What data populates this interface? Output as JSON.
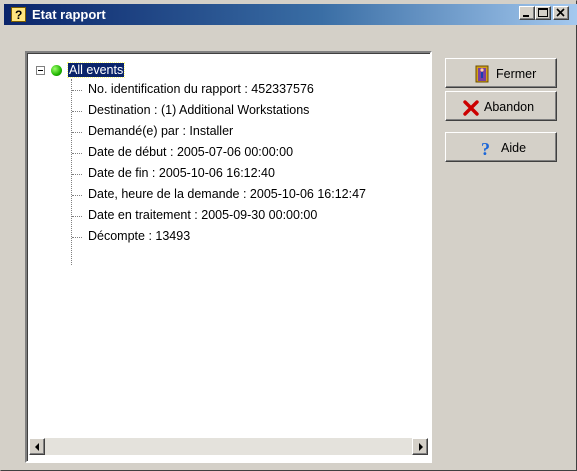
{
  "window": {
    "title": "Etat rapport"
  },
  "tree": {
    "root_label": "All events",
    "items": [
      "No. identification du rapport : 452337576",
      "Destination : (1) Additional Workstations",
      "Demandé(e) par : Installer",
      "Date de début : 2005-07-06 00:00:00",
      "Date de fin : 2005-10-06 16:12:40",
      "Date, heure de la demande : 2005-10-06 16:12:47",
      "Date en traitement : 2005-09-30 00:00:00",
      "Décompte : 13493"
    ]
  },
  "buttons": {
    "fermer": "Fermer",
    "abandon": "Abandon",
    "aide": "Aide"
  },
  "icons": {
    "app": "help-question-icon",
    "fermer": "door-exit-icon",
    "abandon": "red-x-icon",
    "aide": "blue-question-icon",
    "root": "green-status-dot-icon"
  },
  "colors": {
    "title_bar_start": "#0a246a",
    "title_bar_end": "#a6caf0",
    "selection": "#0a246a",
    "status_green": "#1fb400",
    "abandon_red": "#cc0000",
    "aide_blue": "#1a66d9"
  }
}
